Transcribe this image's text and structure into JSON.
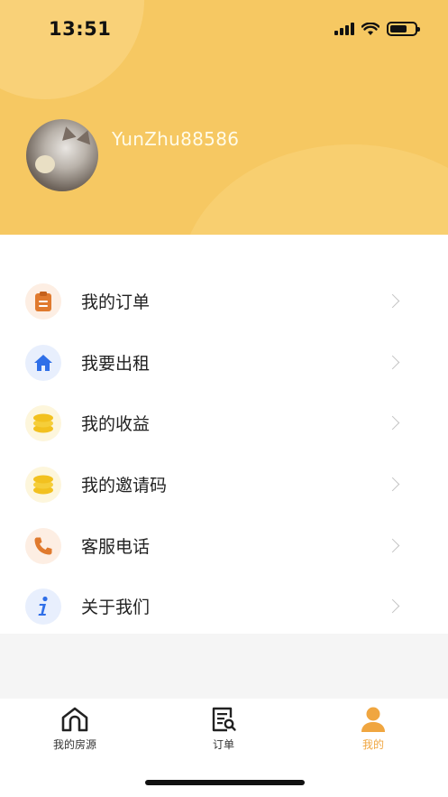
{
  "status_bar": {
    "time": "13:51"
  },
  "profile": {
    "username": "YunZhu88586"
  },
  "menu": {
    "items": [
      {
        "label": "我的订单",
        "icon": "clipboard-icon",
        "color": "#e07a2e",
        "bg": "#fdeee3"
      },
      {
        "label": "我要出租",
        "icon": "house-icon",
        "color": "#2f6fe8",
        "bg": "#e8effd"
      },
      {
        "label": "我的收益",
        "icon": "coins-icon",
        "color": "#f2c11f",
        "bg": "#fdf6dc"
      },
      {
        "label": "我的邀请码",
        "icon": "coins-icon",
        "color": "#f2c11f",
        "bg": "#fdf6dc"
      },
      {
        "label": "客服电话",
        "icon": "phone-icon",
        "color": "#e07a2e",
        "bg": "#fdeee3"
      },
      {
        "label": "关于我们",
        "icon": "info-icon",
        "color": "#2f6fe8",
        "bg": "#e8effd"
      }
    ]
  },
  "tabbar": {
    "tabs": [
      {
        "label": "我的房源",
        "icon": "home-outline-icon",
        "active": false
      },
      {
        "label": "订单",
        "icon": "order-search-icon",
        "active": false
      },
      {
        "label": "我的",
        "icon": "person-icon",
        "active": true
      }
    ],
    "active_color": "#f0a640"
  }
}
